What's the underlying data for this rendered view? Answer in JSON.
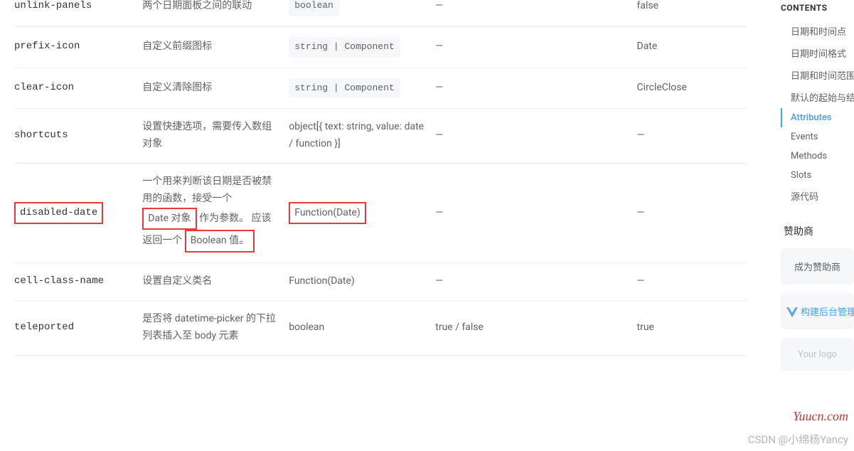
{
  "rows": [
    {
      "name": "unlink-panels",
      "desc": "两个日期面板之间的联动",
      "type_code": "boolean",
      "options": "—",
      "default": "false"
    },
    {
      "name": "prefix-icon",
      "desc": "自定义前缀图标",
      "type_code": "string | Component",
      "options": "—",
      "default": "Date"
    },
    {
      "name": "clear-icon",
      "desc": "自定义清除图标",
      "type_code": "string | Component",
      "options": "—",
      "default": "CircleClose"
    },
    {
      "name": "shortcuts",
      "desc": "设置快捷选项，需要传入数组对象",
      "type_plain": "object[{ text: string, value: date / function }]",
      "options": "—",
      "default": "—"
    },
    {
      "name": "disabled-date",
      "desc_pre": "一个用来判断该日期是否被禁用的函数，接受一个",
      "desc_box1": "Date 对象",
      "desc_mid": "作为参数。 应该返回一个",
      "desc_box2": "Boolean 值。",
      "type_plain": "Function(Date)",
      "options": "—",
      "default": "—",
      "highlight": true
    },
    {
      "name": "cell-class-name",
      "desc": "设置自定义类名",
      "type_plain": "Function(Date)",
      "options": "—",
      "default": "—"
    },
    {
      "name": "teleported",
      "desc": "是否将 datetime-picker 的下拉列表插入至 body 元素",
      "type_plain": "boolean",
      "options": "true / false",
      "default": "true"
    }
  ],
  "toc": {
    "title": "CONTENTS",
    "items": [
      {
        "label": "日期和时间点",
        "active": false
      },
      {
        "label": "日期时间格式",
        "active": false
      },
      {
        "label": "日期和时间范围",
        "active": false
      },
      {
        "label": "默认的起始与结束",
        "active": false
      },
      {
        "label": "Attributes",
        "active": true
      },
      {
        "label": "Events",
        "active": false
      },
      {
        "label": "Methods",
        "active": false
      },
      {
        "label": "Slots",
        "active": false
      },
      {
        "label": "源代码",
        "active": false
      }
    ],
    "sponsor_title": "赞助商",
    "sponsor_btn": "成为赞助商",
    "sponsor_vue": "构建后台管理",
    "sponsor_logo": "Your logo"
  },
  "watermark1": "Yuucn.com",
  "watermark2": "CSDN @小绵杨Yancy"
}
